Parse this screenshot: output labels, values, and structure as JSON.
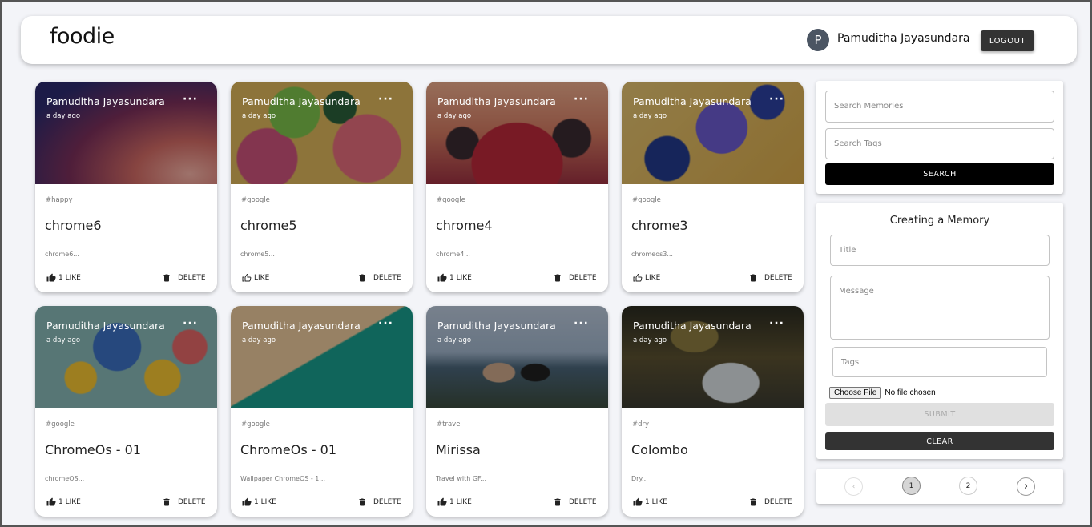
{
  "app": {
    "logo": "foodie"
  },
  "header": {
    "avatar_letter": "P",
    "username": "Pamuditha Jayasundara",
    "logout_label": "LOGOUT"
  },
  "posts": [
    {
      "author": "Pamuditha Jayasundara",
      "time": "a day ago",
      "tags": "#happy",
      "title": "chrome6",
      "message": "chrome6...",
      "like_label": "1 LIKE",
      "delete_label": "DELETE"
    },
    {
      "author": "Pamuditha Jayasundara",
      "time": "a day ago",
      "tags": "#google",
      "title": "chrome5",
      "message": "chrome5...",
      "like_label": "LIKE",
      "delete_label": "DELETE"
    },
    {
      "author": "Pamuditha Jayasundara",
      "time": "a day ago",
      "tags": "#google",
      "title": "chrome4",
      "message": "chrome4...",
      "like_label": "1 LIKE",
      "delete_label": "DELETE"
    },
    {
      "author": "Pamuditha Jayasundara",
      "time": "a day ago",
      "tags": "#google",
      "title": "chrome3",
      "message": "chromeos3...",
      "like_label": "LIKE",
      "delete_label": "DELETE"
    },
    {
      "author": "Pamuditha Jayasundara",
      "time": "a day ago",
      "tags": "#google",
      "title": "ChromeOs - 01",
      "message": "chromeOS...",
      "like_label": "1 LIKE",
      "delete_label": "DELETE"
    },
    {
      "author": "Pamuditha Jayasundara",
      "time": "a day ago",
      "tags": "#google",
      "title": "ChromeOs - 01",
      "message": "Wallpaper ChromeOS - 1...",
      "like_label": "1 LIKE",
      "delete_label": "DELETE"
    },
    {
      "author": "Pamuditha Jayasundara",
      "time": "a day ago",
      "tags": "#travel",
      "title": "Mirissa",
      "message": "Travel with GF...",
      "like_label": "1 LIKE",
      "delete_label": "DELETE"
    },
    {
      "author": "Pamuditha Jayasundara",
      "time": "a day ago",
      "tags": "#dry",
      "title": "Colombo",
      "message": "Dry...",
      "like_label": "1 LIKE",
      "delete_label": "DELETE"
    }
  ],
  "search": {
    "memories_placeholder": "Search Memories",
    "tags_placeholder": "Search Tags",
    "button_label": "SEARCH"
  },
  "form": {
    "heading": "Creating a Memory",
    "title_placeholder": "Title",
    "message_placeholder": "Message",
    "tags_placeholder": "Tags",
    "choose_file_label": "Choose File",
    "no_file_text": "No file chosen",
    "submit_label": "SUBMIT",
    "clear_label": "CLEAR"
  },
  "pagination": {
    "prev_icon": "‹",
    "pages": [
      "1",
      "2"
    ],
    "current": "1",
    "next_icon": "›"
  },
  "icons": {
    "like": "thumb-up-icon",
    "delete": "trash-icon",
    "more": "more-horiz-icon"
  }
}
